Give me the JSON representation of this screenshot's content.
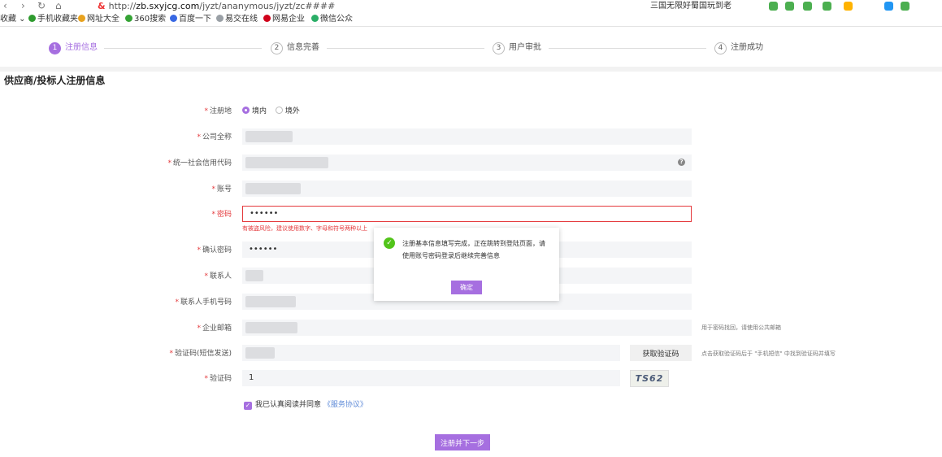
{
  "browser": {
    "url_prefix": "http://",
    "url_domain": "zb.sxyjcg.com",
    "url_path": "/jyzt/ananymous/jyzt/zc####",
    "security_label": "&",
    "tab_title": "三国无限好蜀国玩到老",
    "bookmarks": [
      {
        "label": "收藏 ⌄",
        "color": ""
      },
      {
        "label": "手机收藏夹",
        "color": "#2e9b2e"
      },
      {
        "label": "网址大全",
        "color": "#e8a21e"
      },
      {
        "label": "360搜索",
        "color": "#35a335"
      },
      {
        "label": "百度一下",
        "color": "#3868e3"
      },
      {
        "label": "易交在线",
        "color": "#9aa0a6"
      },
      {
        "label": "网易企业",
        "color": "#d0021b"
      },
      {
        "label": "微信公众",
        "color": "#2aae67"
      }
    ]
  },
  "steps": [
    {
      "num": "1",
      "label": "注册信息"
    },
    {
      "num": "2",
      "label": "信息完善"
    },
    {
      "num": "3",
      "label": "用户审批"
    },
    {
      "num": "4",
      "label": "注册成功"
    }
  ],
  "section_title": "供应商/投标人注册信息",
  "form": {
    "region_label": "注册地",
    "region_option_domestic": "境内",
    "region_option_foreign": "境外",
    "company_label": "公司全称",
    "credit_code_label": "统一社会信用代码",
    "account_label": "账号",
    "password_label": "密码",
    "password_value": "••••••",
    "password_error": "有被盗风险，建议使用数字、字母和符号两种以上",
    "confirm_password_label": "确认密码",
    "confirm_password_value": "••••••",
    "contact_label": "联系人",
    "contact_phone_label": "联系人手机号码",
    "email_label": "企业邮箱",
    "email_hint": "用于密码找回，请使用公共邮箱",
    "sms_code_label": "验证码(短信发送)",
    "get_code_button": "获取验证码",
    "sms_code_hint": "点击获取验证码后于 \"手机短信\" 中找到验证码并填写",
    "captcha_label": "验证码",
    "captcha_value": "1",
    "captcha_image_text": "TS62",
    "agree_text": "我已认真阅读并同意",
    "agree_link": "《服务协议》",
    "submit_button": "注册并下一步"
  },
  "modal": {
    "message": "注册基本信息填写完成，正在跳转到登陆页面，请使用账号密码登录后继续完善信息",
    "confirm_button": "确定"
  },
  "colors": {
    "accent": "#a66fe0",
    "error": "#e4393c",
    "success": "#52c41a"
  }
}
